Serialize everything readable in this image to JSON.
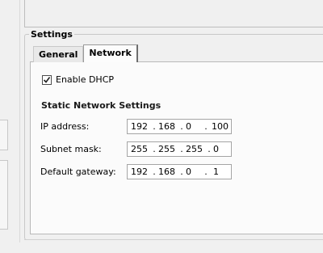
{
  "groupbox": {
    "title": "Settings"
  },
  "tabs": [
    {
      "label": "General",
      "active": false
    },
    {
      "label": "Network",
      "active": true
    }
  ],
  "dhcp": {
    "label": "Enable DHCP",
    "checked": true
  },
  "static_section": {
    "title": "Static Network Settings"
  },
  "fields": {
    "ip": {
      "label": "IP address:",
      "octets": [
        "192",
        "168",
        "0",
        "100"
      ],
      "dots": [
        ".",
        ".",
        "."
      ]
    },
    "mask": {
      "label": "Subnet mask:",
      "octets": [
        "255",
        "255",
        "255",
        "0"
      ],
      "dots": [
        ".",
        ".",
        "."
      ]
    },
    "gateway": {
      "label": "Default gateway:",
      "octets": [
        "192",
        "168",
        "0",
        "1"
      ],
      "dots": [
        ".",
        ".",
        "."
      ]
    }
  },
  "colors": {
    "background": "#f0f0f0",
    "tab_page": "#fbfbfb",
    "input_border": "#a5a5a5"
  }
}
